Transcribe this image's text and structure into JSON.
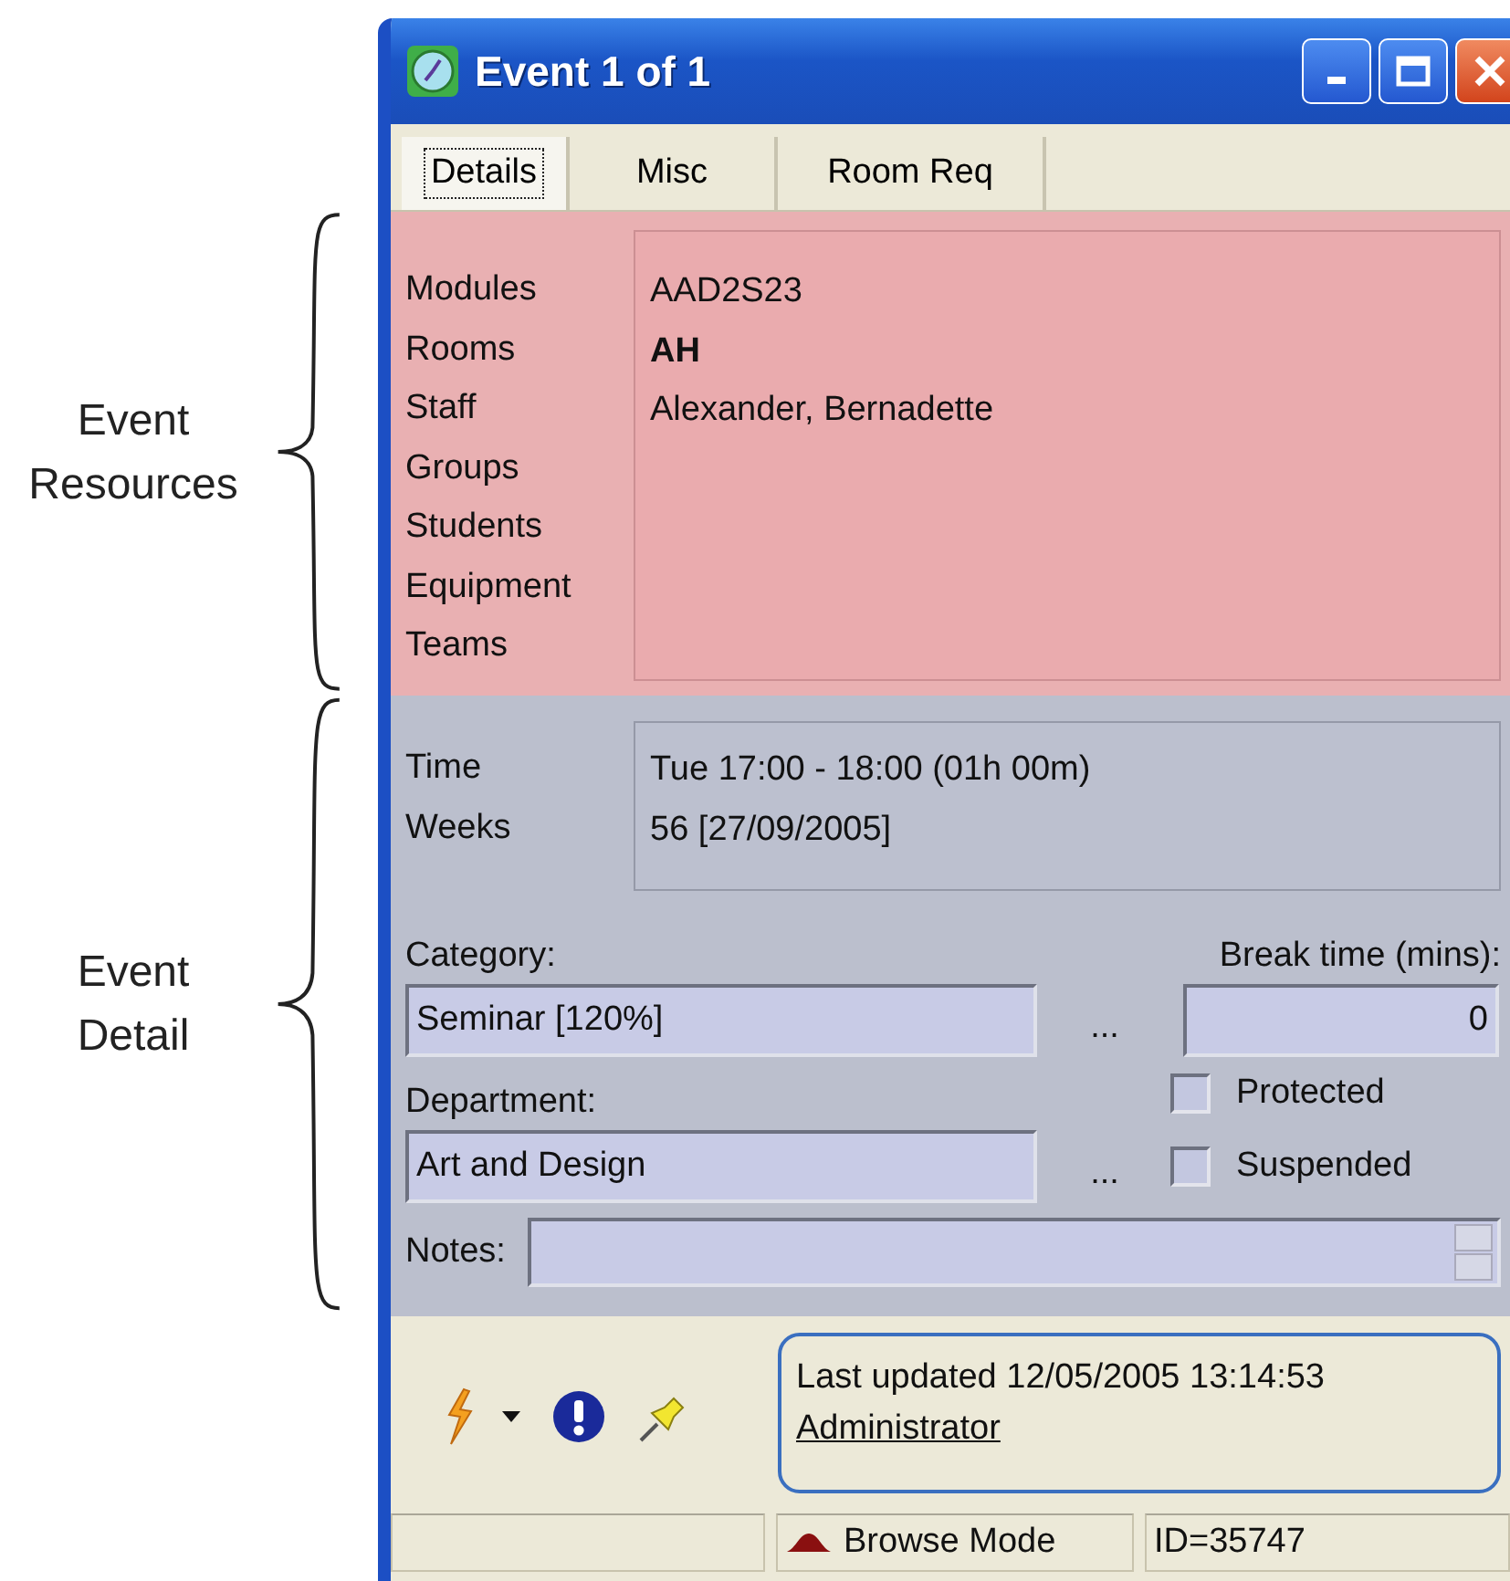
{
  "annotations": [
    {
      "label": "Event Resources"
    },
    {
      "label": "Event Detail"
    }
  ],
  "window": {
    "title": "Event 1 of 1"
  },
  "tabs": [
    {
      "label": "Details",
      "selected": true
    },
    {
      "label": "Misc",
      "selected": false
    },
    {
      "label": "Room Req",
      "selected": false
    }
  ],
  "resources": {
    "labels": [
      "Modules",
      "Rooms",
      "Staff",
      "Groups",
      "Students",
      "Equipment",
      "Teams"
    ],
    "values": [
      {
        "text": "AAD2S23",
        "bold": false
      },
      {
        "text": "AH",
        "bold": true
      },
      {
        "text": "Alexander, Bernadette",
        "bold": false
      }
    ]
  },
  "detail": {
    "labels": [
      "Time",
      "Weeks"
    ],
    "values": [
      "Tue 17:00 - 18:00 (01h 00m)",
      "56 [27/09/2005]"
    ],
    "fields": [
      {
        "label": "Category:",
        "value": "Seminar [120%]",
        "more": "..."
      },
      {
        "label": "Department:",
        "value": "Art and Design",
        "more": "..."
      }
    ],
    "break_time": {
      "label": "Break time (mins):",
      "value": "0"
    },
    "checkboxes": [
      {
        "label": "Protected",
        "checked": false
      },
      {
        "label": "Suspended",
        "checked": false
      }
    ],
    "notes": {
      "label": "Notes:"
    }
  },
  "info": {
    "text": "Last updated 12/05/2005 13:14:53",
    "link": "Administrator"
  },
  "status_bar": {
    "mode": "Browse Mode",
    "id": "ID=35747"
  }
}
